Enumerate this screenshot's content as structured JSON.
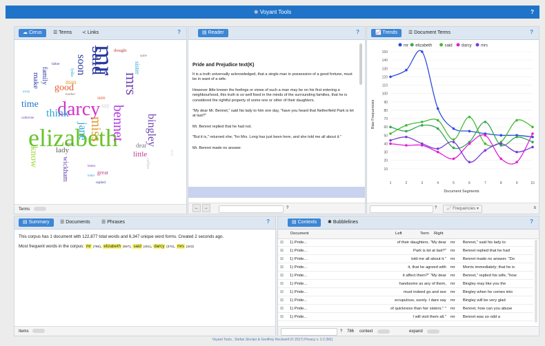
{
  "app": {
    "title": "Voyant Tools",
    "help": "?"
  },
  "cirrus": {
    "tabs": [
      {
        "label": "Cirrus"
      },
      {
        "label": "Terms"
      },
      {
        "label": "Links"
      }
    ],
    "footer_label": "Terms",
    "words": [
      {
        "t": "mr",
        "c": "#2b3aa0"
      },
      {
        "t": "elizabeth",
        "c": "#66c52a"
      },
      {
        "t": "darcy",
        "c": "#d431c8"
      },
      {
        "t": "said",
        "c": "#2b3aa0"
      },
      {
        "t": "mrs",
        "c": "#6a3fb0"
      },
      {
        "t": "bennet",
        "c": "#b23ae0"
      },
      {
        "t": "miss",
        "c": "#e29a2b"
      },
      {
        "t": "jane",
        "c": "#2aa5d6"
      },
      {
        "t": "bingley",
        "c": "#6a3fb0"
      },
      {
        "t": "know",
        "c": "#a0d83a"
      },
      {
        "t": "think",
        "c": "#2aa5d6"
      },
      {
        "t": "time",
        "c": "#1f73c9"
      },
      {
        "t": "good",
        "c": "#e25a2b"
      },
      {
        "t": "soon",
        "c": "#2b3aa0"
      },
      {
        "t": "lady",
        "c": "#5d5d5d"
      },
      {
        "t": "little",
        "c": "#c23a8c"
      },
      {
        "t": "wickham",
        "c": "#6a3fb0"
      },
      {
        "t": "make",
        "c": "#2b3aa0"
      },
      {
        "t": "sister",
        "c": "#2aa5d6"
      },
      {
        "t": "dear",
        "c": "#7a7a7a"
      },
      {
        "t": "family",
        "c": "#2b3aa0"
      },
      {
        "t": "man",
        "c": "#e29a2b"
      },
      {
        "t": "say",
        "c": "#d0d0d0"
      },
      {
        "t": "great",
        "c": "#c23a8c"
      },
      {
        "t": "lydia",
        "c": "#2aa5d6"
      },
      {
        "t": "thought",
        "c": "#b23a2b"
      },
      {
        "t": "collins",
        "c": "#c0c0c0"
      },
      {
        "t": "shall",
        "c": "#d8d8d8"
      },
      {
        "t": "catherine",
        "c": "#6a3fb0"
      },
      {
        "t": "house",
        "c": "#5d5d5d"
      },
      {
        "t": "away",
        "c": "#2aa5d6"
      },
      {
        "t": "better",
        "c": "#7a3fb0"
      },
      {
        "t": "sure",
        "c": "#e25a2b"
      },
      {
        "t": "mother",
        "c": "#7a7a7a"
      },
      {
        "t": "father",
        "c": "#2b3aa0"
      },
      {
        "t": "replied",
        "c": "#2b3aa0"
      },
      {
        "t": "letter",
        "c": "#2aa5d6"
      },
      {
        "t": "quite",
        "c": "#7a7a7a"
      }
    ]
  },
  "reader": {
    "tab": "Reader",
    "title": "Pride and Prejudice text(K)",
    "paragraphs": [
      "It is a truth universally acknowledged, that a single man in possession of a good fortune, must be in want of a wife.",
      "However little known the feelings or views of such a man may be on his first entering a neighbourhood, this truth is so well fixed in the minds of the surrounding families, that he is considered the rightful property of some one or other of their daughters.",
      "\"My dear Mr. Bennet,\" said his lady to him one day, \"have you heard that Netherfield Park is let at last?\"",
      "Mr. Bennet replied that he had not.",
      "\"But it is,\" returned she; \"for Mrs. Long has just been here, and she told me all about it.\"",
      "Mr. Bennet made no answer."
    ]
  },
  "trends": {
    "tabs": [
      {
        "label": "Trends"
      },
      {
        "label": "Document Terms"
      }
    ],
    "frequencies_label": "Frequencies",
    "help": "?"
  },
  "chart_data": {
    "type": "line",
    "xlabel": "Document Segments",
    "ylabel": "Raw Frequencies",
    "x": [
      1,
      2,
      3,
      4,
      5,
      6,
      7,
      8,
      9,
      10
    ],
    "ylim": [
      0,
      150
    ],
    "yticks": [
      10,
      20,
      30,
      40,
      50,
      60,
      70,
      80,
      90,
      100,
      110,
      120,
      130,
      140,
      150
    ],
    "legend_position": "top",
    "series": [
      {
        "name": "mr",
        "color": "#2a4be0",
        "values": [
          120,
          128,
          150,
          82,
          58,
          55,
          52,
          50,
          50,
          48
        ]
      },
      {
        "name": "elizabeth",
        "color": "#35a853",
        "values": [
          60,
          55,
          62,
          58,
          35,
          42,
          66,
          38,
          48,
          42
        ]
      },
      {
        "name": "said",
        "color": "#44bb33",
        "values": [
          52,
          62,
          66,
          68,
          45,
          72,
          40,
          42,
          68,
          60
        ]
      },
      {
        "name": "darcy",
        "color": "#e01fd8",
        "values": [
          40,
          38,
          38,
          30,
          22,
          40,
          50,
          22,
          18,
          52
        ]
      },
      {
        "name": "mrs",
        "color": "#7a3ad8",
        "values": [
          44,
          48,
          40,
          34,
          42,
          18,
          32,
          40,
          30,
          36
        ]
      }
    ]
  },
  "summary": {
    "tabs": [
      {
        "label": "Summary"
      },
      {
        "label": "Documents"
      },
      {
        "label": "Phrases"
      }
    ],
    "text": "This corpus has 1 document with 122,877 total words and 6,347 unique word forms. Created 2 seconds ago.",
    "freq_label": "Most frequent words in the corpus:",
    "freq_words": [
      {
        "word": "mr",
        "count": "(786)"
      },
      {
        "word": "elizabeth",
        "count": "(597)"
      },
      {
        "word": "said",
        "count": "(401)"
      },
      {
        "word": "darcy",
        "count": "(374)"
      },
      {
        "word": "mrs",
        "count": "(343)"
      }
    ],
    "footer_label": "Items"
  },
  "contexts": {
    "tabs": [
      {
        "label": "Contexts"
      },
      {
        "label": "Bubblelines"
      }
    ],
    "headers": {
      "document": "Document",
      "left": "Left",
      "term": "Term",
      "right": "Right"
    },
    "rows": [
      {
        "doc": "1) Pride...",
        "left": "of their daughters. \"My dear",
        "term": "mr",
        "right": "Bennet,\" said his lady to"
      },
      {
        "doc": "1) Pride...",
        "left": "Park is let at last?\"",
        "term": "mr",
        "right": "Bennet replied that he had"
      },
      {
        "doc": "1) Pride...",
        "left": "told me all about it.\"",
        "term": "mr",
        "right": "Bennet made no answer. \"Do"
      },
      {
        "doc": "1) Pride...",
        "left": "it, that he agreed with",
        "term": "mr",
        "right": "Morris immediately; that he is"
      },
      {
        "doc": "1) Pride...",
        "left": "it affect them?\" \"My dear",
        "term": "mr",
        "right": "Bennet,\" replied his wife, \"how"
      },
      {
        "doc": "1) Pride...",
        "left": "handsome as any of them,",
        "term": "mr",
        "right": "Bingley may like you the"
      },
      {
        "doc": "1) Pride...",
        "left": "must indeed go and see",
        "term": "mr",
        "right": "Bingley when he comes into"
      },
      {
        "doc": "1) Pride...",
        "left": "scrupulous, surely. I dare say",
        "term": "mr",
        "right": "Bingley will be very glad"
      },
      {
        "doc": "1) Pride...",
        "left": "of quickness than her sisters.\" \"",
        "term": "mr",
        "right": "Bennet, how can you abuse"
      },
      {
        "doc": "1) Pride...",
        "left": "I will visit them all.\"",
        "term": "mr",
        "right": "Bennet was so odd a"
      }
    ],
    "footer": {
      "count": "786",
      "context_label": "context",
      "expand_label": "expand"
    }
  },
  "bottom_text": "Voyant Tools , Stefan Sinclair & Geoffrey Rockwell (© 2017) Privacy v. 2.2 (M1)"
}
